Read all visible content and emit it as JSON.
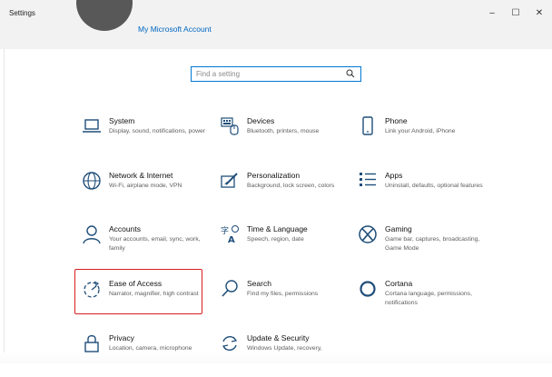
{
  "window": {
    "title": "Settings",
    "controls": {
      "minimize": "–",
      "maximize": "☐",
      "close": "✕"
    }
  },
  "header": {
    "account_link": "My Microsoft Account"
  },
  "search": {
    "placeholder": "Find a setting",
    "icon": "search-icon"
  },
  "tiles": [
    {
      "name": "System",
      "desc": "Display, sound, notifications, power",
      "icon": "laptop-icon"
    },
    {
      "name": "Devices",
      "desc": "Bluetooth, printers, mouse",
      "icon": "keyboard-icon"
    },
    {
      "name": "Phone",
      "desc": "Link your Android, iPhone",
      "icon": "phone-icon"
    },
    {
      "name": "Network & Internet",
      "desc": "Wi-Fi, airplane mode, VPN",
      "icon": "globe-icon"
    },
    {
      "name": "Personalization",
      "desc": "Background, lock screen, colors",
      "icon": "paint-icon"
    },
    {
      "name": "Apps",
      "desc": "Uninstall, defaults, optional features",
      "icon": "apps-list-icon"
    },
    {
      "name": "Accounts",
      "desc": "Your accounts, email, sync, work, family",
      "icon": "person-icon"
    },
    {
      "name": "Time & Language",
      "desc": "Speech, region, date",
      "icon": "time-language-icon"
    },
    {
      "name": "Gaming",
      "desc": "Game bar, captures, broadcasting, Game Mode",
      "icon": "xbox-icon"
    },
    {
      "name": "Ease of Access",
      "desc": "Narrator, magnifier, high contrast",
      "icon": "ease-of-access-icon"
    },
    {
      "name": "Search",
      "desc": "Find my files, permissions",
      "icon": "search-icon"
    },
    {
      "name": "Cortana",
      "desc": "Cortana language, permissions, notifications",
      "icon": "cortana-icon"
    },
    {
      "name": "Privacy",
      "desc": "Location, camera, microphone",
      "icon": "lock-icon"
    },
    {
      "name": "Update & Security",
      "desc": "Windows Update, recovery,",
      "icon": "update-icon"
    }
  ],
  "colors": {
    "accent": "#0078d4",
    "link": "#0067c0",
    "highlight_box": "#d62020",
    "titlebar": "#f2f2f2"
  }
}
